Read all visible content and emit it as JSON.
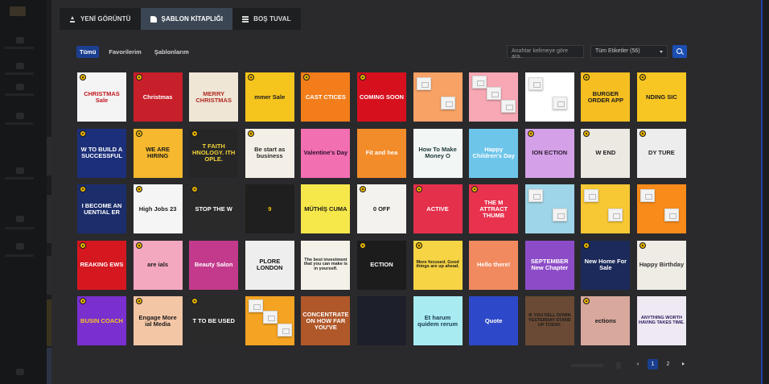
{
  "tabs": [
    {
      "label": "YENİ GÖRÜNTÜ",
      "icon": "upload-icon"
    },
    {
      "label": "ŞABLON KİTAPLIĞI",
      "icon": "library-icon"
    },
    {
      "label": "BOŞ TUVAL",
      "icon": "grid-icon"
    }
  ],
  "filters": [
    {
      "label": "Tümü"
    },
    {
      "label": "Favorilerim"
    },
    {
      "label": "Şablonlarım"
    }
  ],
  "search": {
    "placeholder": "Anahtar kelimeye göre ara..",
    "tag_filter": "Tüm Etiketler (56)",
    "button_icon": "search-icon"
  },
  "templates": [
    {
      "text": "CHRISTMAS Sale",
      "bg": "#f4f4f4",
      "fg": "#c0171f",
      "premium": true
    },
    {
      "text": "Christmas",
      "bg": "#c8202a",
      "fg": "#ffffff",
      "premium": true
    },
    {
      "text": "MERRY CHRISTMAS",
      "bg": "#efe6d6",
      "fg": "#b22a22",
      "premium": false
    },
    {
      "text": "mmer Sale",
      "bg": "#f6c51d",
      "fg": "#1e1e1e",
      "premium": true
    },
    {
      "text": "CAST CTICES",
      "bg": "#f27d1a",
      "fg": "#ffffff",
      "premium": true
    },
    {
      "text": "COMING SOON",
      "bg": "#d7101e",
      "fg": "#ffffff",
      "premium": true
    },
    {
      "text": "",
      "bg": "#f8a266",
      "fg": "#ffffff",
      "premium": false,
      "photos": 2
    },
    {
      "text": "",
      "bg": "#f7a8b4",
      "fg": "#ffffff",
      "premium": false,
      "photos": 3
    },
    {
      "text": "",
      "bg": "#ffffff",
      "fg": "#333333",
      "premium": false,
      "photos": 2
    },
    {
      "text": "BURGER ORDER APP",
      "bg": "#f5bf22",
      "fg": "#1b1b1b",
      "premium": true
    },
    {
      "text": "NDING SIC",
      "bg": "#f7c623",
      "fg": "#1b1b1b",
      "premium": true
    },
    {
      "text": "W TO BUILD A SUCCESSFUL",
      "bg": "#1c2f7a",
      "fg": "#ffffff",
      "premium": true
    },
    {
      "text": "WE ARE HIRING",
      "bg": "#f5b82e",
      "fg": "#1b1b1b",
      "premium": true
    },
    {
      "text": "T FAITH HNOLOGY. ITH OPLE.",
      "bg": "#262626",
      "fg": "#f2d43a",
      "premium": true
    },
    {
      "text": "Be start as business",
      "bg": "#f4efe6",
      "fg": "#2b2b2b",
      "premium": true
    },
    {
      "text": "Valentine's Day",
      "bg": "#f26fb1",
      "fg": "#2b1030",
      "premium": false
    },
    {
      "text": "Fit and hea",
      "bg": "#f28b2a",
      "fg": "#ffffff",
      "premium": false
    },
    {
      "text": "How To Make Money O",
      "bg": "#f2f6f5",
      "fg": "#1e3a38",
      "premium": false
    },
    {
      "text": "Happy Children's Day",
      "bg": "#6ec5ea",
      "fg": "#ffffff",
      "premium": false
    },
    {
      "text": "ION ECTION",
      "bg": "#d4a1e8",
      "fg": "#2a1a2e",
      "premium": true
    },
    {
      "text": "W END",
      "bg": "#ece8e2",
      "fg": "#222222",
      "premium": true
    },
    {
      "text": "DY TURE",
      "bg": "#ededed",
      "fg": "#222222",
      "premium": true
    },
    {
      "text": "I BECOME AN UENTIAL ER",
      "bg": "#1b2d6b",
      "fg": "#ffffff",
      "premium": true
    },
    {
      "text": "High Jobs 23",
      "bg": "#f5f5f5",
      "fg": "#1b1b1b",
      "premium": true
    },
    {
      "text": "STOP THE W",
      "bg": "#2a2a2a",
      "fg": "#ffffff",
      "premium": true
    },
    {
      "text": "9",
      "bg": "#1f1f1f",
      "fg": "#f5c400",
      "premium": false
    },
    {
      "text": "MÜTHİŞ CUMA",
      "bg": "#f6e84a",
      "fg": "#1b1b1b",
      "premium": false
    },
    {
      "text": "0 OFF",
      "bg": "#f4f2ee",
      "fg": "#1b1b1b",
      "premium": true
    },
    {
      "text": "ACTIVE",
      "bg": "#e5304c",
      "fg": "#ffffff",
      "premium": true
    },
    {
      "text": "THE M ATTRACT THUMB",
      "bg": "#e8324e",
      "fg": "#ffffff",
      "premium": true
    },
    {
      "text": "",
      "bg": "#9fd5e8",
      "fg": "#ffffff",
      "premium": false,
      "photos": 2
    },
    {
      "text": "",
      "bg": "#f7c734",
      "fg": "#ffffff",
      "premium": false,
      "photos": 2
    },
    {
      "text": "",
      "bg": "#f98b1b",
      "fg": "#ffffff",
      "premium": false,
      "photos": 2
    },
    {
      "text": "REAKING EWS",
      "bg": "#d5171f",
      "fg": "#ffffff",
      "premium": true
    },
    {
      "text": "are ials",
      "bg": "#f3a8c0",
      "fg": "#1b1b1b",
      "premium": true
    },
    {
      "text": "Beauty Salon",
      "bg": "#c33a8c",
      "fg": "#ffffff",
      "premium": false
    },
    {
      "text": "PLORE LONDON",
      "bg": "#eeeeee",
      "fg": "#111111",
      "premium": false
    },
    {
      "text": "The best investment that you can make is in yourself.",
      "bg": "#f4f1e8",
      "fg": "#222222",
      "premium": false
    },
    {
      "text": "ECTION",
      "bg": "#1c1c1c",
      "fg": "#ffffff",
      "premium": true
    },
    {
      "text": "More focused. Good things are up ahead.",
      "bg": "#f6d443",
      "fg": "#1b1b1b",
      "premium": true
    },
    {
      "text": "Hello there!",
      "bg": "#f28a5f",
      "fg": "#ffffff",
      "premium": false
    },
    {
      "text": "SEPTEMBER New Chapter",
      "bg": "#8d4cc7",
      "fg": "#ffffff",
      "premium": false
    },
    {
      "text": "New Home For Sale",
      "bg": "#1b2a5a",
      "fg": "#ffffff",
      "premium": true
    },
    {
      "text": "Happy Birthday",
      "bg": "#efece6",
      "fg": "#333333",
      "premium": true
    },
    {
      "text": "BUSIN COACH",
      "bg": "#7a2fcf",
      "fg": "#f7c623",
      "premium": true
    },
    {
      "text": "Engage More ial Media",
      "bg": "#f3c6a6",
      "fg": "#1b1b1b",
      "premium": true
    },
    {
      "text": "T TO BE USED",
      "bg": "#2a2a2a",
      "fg": "#ffffff",
      "premium": true
    },
    {
      "text": "",
      "bg": "#f4a322",
      "fg": "#ffffff",
      "premium": false,
      "photos": 3
    },
    {
      "text": "CONCENTRATE ON HOW FAR YOU'VE",
      "bg": "#b0582a",
      "fg": "#ffffff",
      "premium": false
    },
    {
      "text": "",
      "bg": "#1d1f2a",
      "fg": "#ffffff",
      "premium": false
    },
    {
      "text": "Et harum quidem rerum",
      "bg": "#a8ecf1",
      "fg": "#1b3a50",
      "premium": false
    },
    {
      "text": "Quote",
      "bg": "#2d49c9",
      "fg": "#ffffff",
      "premium": false
    },
    {
      "text": "IF YOU FELL DOWN YESTERDAY STAND UP TODAY.",
      "bg": "#6a4a34",
      "fg": "#1b1b1b",
      "premium": false
    },
    {
      "text": "ections",
      "bg": "#d8a89c",
      "fg": "#1b1b1b",
      "premium": true
    },
    {
      "text": "ANYTHING WORTH HAVING TAKES TIME.",
      "bg": "#efe9f3",
      "fg": "#2a1a5a",
      "premium": false
    }
  ],
  "pagination": {
    "pages": [
      "1",
      "2"
    ],
    "current": "1"
  }
}
